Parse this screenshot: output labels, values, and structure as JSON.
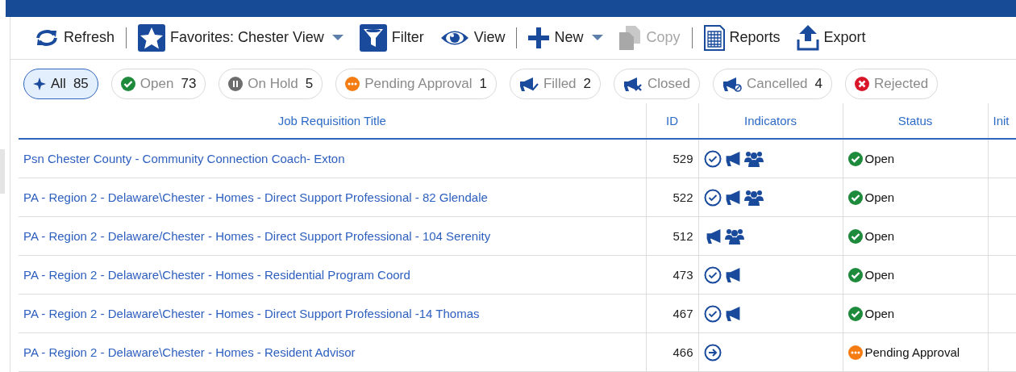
{
  "toolbar_groups": [
    {
      "items": [
        {
          "kind": "refresh",
          "label": "Refresh",
          "disabled": false,
          "dropdown": false
        }
      ]
    },
    {
      "items": [
        {
          "kind": "star",
          "label": "Favorites: Chester View",
          "disabled": false,
          "dropdown": true
        },
        {
          "kind": "filter",
          "label": "Filter",
          "disabled": false,
          "dropdown": false
        },
        {
          "kind": "eye",
          "label": "View",
          "disabled": false,
          "dropdown": false
        }
      ]
    },
    {
      "items": [
        {
          "kind": "plus",
          "label": "New",
          "disabled": false,
          "dropdown": true
        },
        {
          "kind": "copy",
          "label": "Copy",
          "disabled": true,
          "dropdown": false
        }
      ]
    },
    {
      "items": [
        {
          "kind": "reports",
          "label": "Reports",
          "disabled": false,
          "dropdown": false
        },
        {
          "kind": "export",
          "label": "Export",
          "disabled": false,
          "dropdown": false
        }
      ]
    }
  ],
  "filters": [
    {
      "kind": "all",
      "label": "All",
      "count": "85",
      "selected": true
    },
    {
      "kind": "open",
      "label": "Open",
      "count": "73",
      "selected": false
    },
    {
      "kind": "hold",
      "label": "On Hold",
      "count": "5",
      "selected": false
    },
    {
      "kind": "pending",
      "label": "Pending Approval",
      "count": "1",
      "selected": false
    },
    {
      "kind": "filled",
      "label": "Filled",
      "count": "2",
      "selected": false
    },
    {
      "kind": "closed",
      "label": "Closed",
      "selected": false
    },
    {
      "kind": "cancelled",
      "label": "Cancelled",
      "count": "4",
      "selected": false
    },
    {
      "kind": "rejected",
      "label": "Rejected",
      "selected": false
    }
  ],
  "table": {
    "columns": [
      "Job Requisition Title",
      "ID",
      "Indicators",
      "Status",
      "Init"
    ],
    "rows": [
      {
        "title": "Psn Chester County - Community Connection Coach- Exton",
        "id": "529",
        "indicators": [
          {
            "kind": "check"
          },
          {
            "kind": "megaphone"
          },
          {
            "kind": "people"
          }
        ],
        "status": {
          "kind": "open",
          "label": "Open"
        }
      },
      {
        "title": "PA - Region 2 - Delaware\\Chester - Homes - Direct Support Professional - 82 Glendale",
        "id": "522",
        "indicators": [
          {
            "kind": "check"
          },
          {
            "kind": "megaphone"
          },
          {
            "kind": "people"
          }
        ],
        "status": {
          "kind": "open",
          "label": "Open"
        }
      },
      {
        "title": "PA - Region 2 - Delaware/Chester - Homes - Direct Support Professional - 104 Serenity",
        "id": "512",
        "indicators": [
          {
            "kind": "megaphone"
          },
          {
            "kind": "people"
          }
        ],
        "status": {
          "kind": "open",
          "label": "Open"
        }
      },
      {
        "title": "PA - Region 2 - Delaware\\Chester - Homes - Residential Program Coord",
        "id": "473",
        "indicators": [
          {
            "kind": "check"
          },
          {
            "kind": "megaphone"
          }
        ],
        "status": {
          "kind": "open",
          "label": "Open"
        }
      },
      {
        "title": "PA - Region 2 - Delaware\\Chester - Homes - Direct Support Professional -14 Thomas",
        "id": "467",
        "indicators": [
          {
            "kind": "check"
          },
          {
            "kind": "megaphone"
          }
        ],
        "status": {
          "kind": "open",
          "label": "Open"
        }
      },
      {
        "title": "PA - Region 2 - Delaware\\Chester - Homes - Resident Advisor",
        "id": "466",
        "indicators": [
          {
            "kind": "arrow"
          }
        ],
        "status": {
          "kind": "pending",
          "label": "Pending Approval"
        }
      }
    ]
  }
}
